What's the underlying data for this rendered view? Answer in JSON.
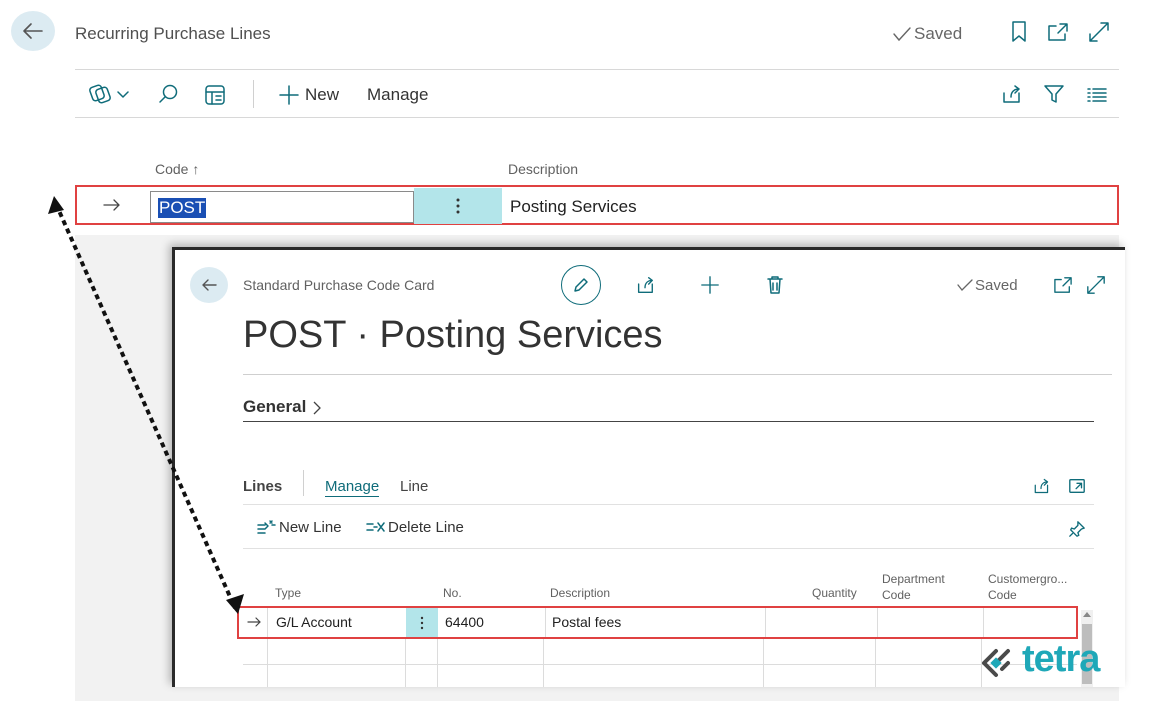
{
  "list_page": {
    "title": "Recurring Purchase Lines",
    "status": "Saved",
    "actions": {
      "new": "New",
      "manage": "Manage"
    },
    "columns": {
      "code": "Code",
      "code_sort": "↑",
      "description": "Description"
    },
    "selected_row": {
      "code": "POST",
      "description": "Posting Services"
    }
  },
  "card_page": {
    "caption": "Standard Purchase Code Card",
    "status": "Saved",
    "title": "POST · Posting Services",
    "section_general": "General",
    "lines": {
      "label": "Lines",
      "tabs": [
        "Manage",
        "Line"
      ],
      "actions": {
        "new_line": "New Line",
        "delete_line": "Delete Line"
      },
      "columns": {
        "type": "Type",
        "no": "No.",
        "description": "Description",
        "quantity": "Quantity",
        "department_code_1": "Department",
        "department_code_2": "Code",
        "customergroup_code_1": "Customergro...",
        "customergroup_code_2": "Code"
      },
      "rows": [
        {
          "type": "G/L Account",
          "no": "64400",
          "description": "Postal fees"
        }
      ]
    }
  },
  "watermark": {
    "text": "tetra"
  },
  "colors": {
    "accent": "#0f6c7a",
    "highlight": "#e04141",
    "selection": "#1a4fb4",
    "teal_cell": "#b3e5ea",
    "watermark": "#1fa8b8"
  }
}
